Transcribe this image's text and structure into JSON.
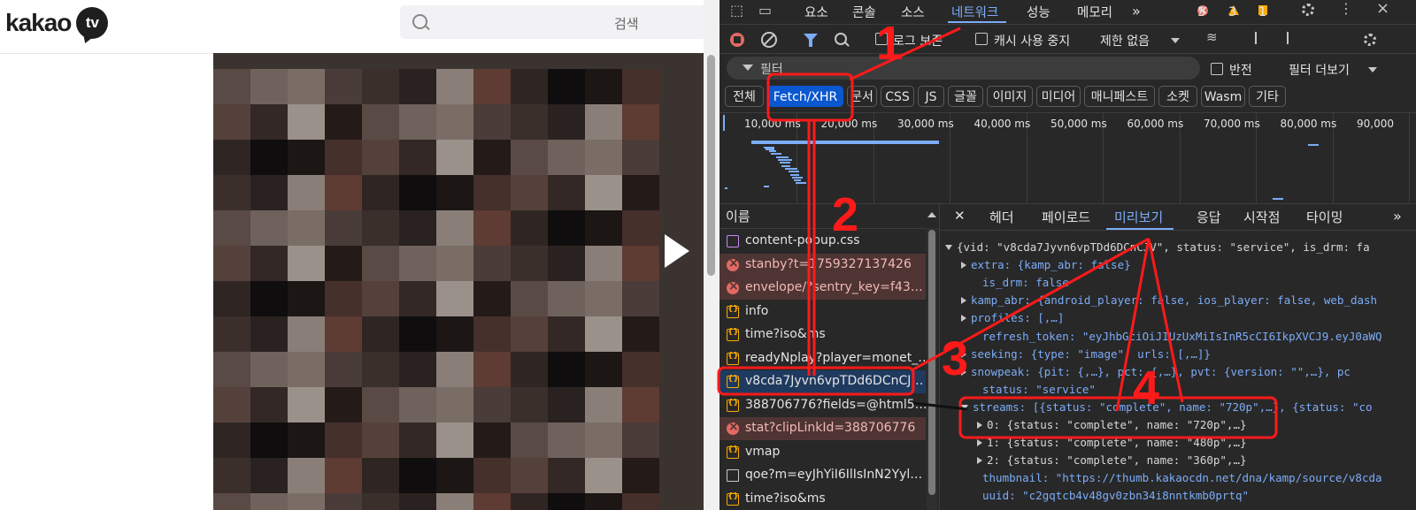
{
  "site": {
    "logo_text": "kakao",
    "logo_badge": "tv",
    "search_placeholder": "검색"
  },
  "devtools": {
    "tabs": [
      "요소",
      "콘솔",
      "소스",
      "네트워크",
      "성능",
      "메모리"
    ],
    "more_tabs": "»",
    "active_tab": "네트워크",
    "badges": {
      "errors": "5",
      "warnings": "3",
      "info": "1"
    },
    "toolbar": {
      "preserve_log": "로그 보존",
      "disable_cache": "캐시 사용 중지",
      "throttle": "제한 없음"
    },
    "filter": {
      "placeholder": "필터",
      "invert": "반전",
      "more_filters": "필터 더보기"
    },
    "type_chips": [
      "전체",
      "Fetch/XHR",
      "문서",
      "CSS",
      "JS",
      "글꼴",
      "이미지",
      "미디어",
      "매니페스트",
      "소켓",
      "Wasm",
      "기타"
    ],
    "active_chip": "Fetch/XHR",
    "timeline_labels": [
      "10,000 ms",
      "20,000 ms",
      "30,000 ms",
      "40,000 ms",
      "50,000 ms",
      "60,000 ms",
      "70,000 ms",
      "80,000 ms",
      "90,000"
    ],
    "list_header": "이름",
    "requests": [
      {
        "name": "content-popup.css",
        "type": "css"
      },
      {
        "name": "stanby?t=1759327137426",
        "type": "error"
      },
      {
        "name": "envelope/?sentry_key=f43…",
        "type": "error"
      },
      {
        "name": "info",
        "type": "json"
      },
      {
        "name": "time?iso&ms",
        "type": "json"
      },
      {
        "name": "readyNplay?player=monet_…",
        "type": "json"
      },
      {
        "name": "v8cda7Jyvn6vpTDd6DCnCJ…",
        "type": "json"
      },
      {
        "name": "388706776?fields=@html5…",
        "type": "json"
      },
      {
        "name": "stat?clipLinkId=388706776",
        "type": "error"
      },
      {
        "name": "vmap",
        "type": "json"
      },
      {
        "name": "qoe?m=eyJhYiI6IlIsInN2Yyl…",
        "type": "doc"
      },
      {
        "name": "time?iso&ms",
        "type": "json"
      }
    ],
    "detail_tabs": [
      "헤더",
      "페이로드",
      "미리보기",
      "응답",
      "시작점",
      "타이밍"
    ],
    "active_detail_tab": "미리보기",
    "preview_lines": [
      "{vid: \"v8cda7Jyvn6vpTDd6DCnCJV\", status: \"service\", is_drm: fa",
      "extra: {kamp_abr: false}",
      "is_drm: false",
      "kamp_abr: {android_player: false, ios_player: false, web_dash",
      "profiles: [,…]",
      "refresh_token: \"eyJhbGciOiJIUzUxMiIsInR5cCI6IkpXVCJ9.eyJ0aWQ",
      "seeking: {type: \"image\", urls: [,…]}",
      "snowpeak: {pit: {,…}, pct: {,…}, pvt: {version: \"\",…}, pc",
      "status: \"service\"",
      "streams: [{status: \"complete\", name: \"720p\",…}, {status: \"co",
      "0: {status: \"complete\", name: \"720p\",…}",
      "1: {status: \"complete\", name: \"480p\",…}",
      "2: {status: \"complete\", name: \"360p\",…}",
      "thumbnail: \"https://thumb.kakaocdn.net/dna/kamp/source/v8cda",
      "uuid: \"c2gqtcb4v48gv0zbn34i8nntkmb0prtq\""
    ]
  },
  "annotations": [
    "1",
    "2",
    "3",
    "4"
  ],
  "colors": {
    "annotation": "#ff1a1a",
    "devtools_bg": "#282828",
    "accent": "#7cacf8",
    "chip_active": "#0b57d0"
  }
}
